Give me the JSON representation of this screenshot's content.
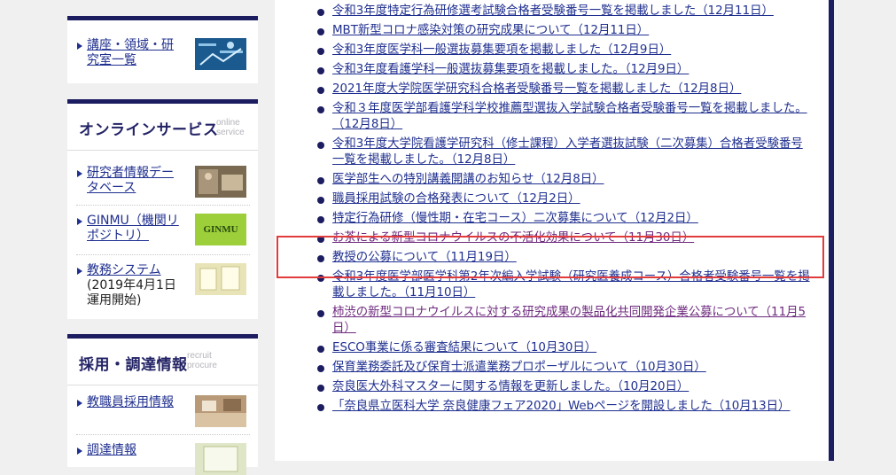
{
  "sidebar": {
    "course_link": "講座・領域・研究室一覧",
    "online": {
      "title_jp": "オンラインサービス",
      "title_en_1": "online",
      "title_en_2": "service",
      "items": [
        {
          "label": "研究者情報データベース",
          "sub": ""
        },
        {
          "label": "GINMU（機関リポジトリ）",
          "sub": "",
          "thumb_text": "GINMU"
        },
        {
          "label": "教務システム",
          "sub": "(2019年4月1日運用開始)"
        }
      ]
    },
    "recruit": {
      "title_jp": "採用・調達情報",
      "title_en_1": "recruit",
      "title_en_2": "procure",
      "items": [
        {
          "label": "教職員採用情報"
        },
        {
          "label": "調達情報"
        }
      ]
    }
  },
  "news": [
    {
      "text": "令和3年度特定行為研修選考試験合格者受験番号一覧を掲載しました（12月11日）",
      "visited": false
    },
    {
      "text": "MBT新型コロナ感染対策の研究成果について（12月11日）",
      "visited": false
    },
    {
      "text": "令和3年度医学科一般選抜募集要項を掲載しました（12月9日）",
      "visited": false
    },
    {
      "text": "令和3年度看護学科一般選抜募集要項を掲載しました。（12月9日）",
      "visited": false
    },
    {
      "text": "2021年度大学院医学研究科合格者受験番号一覧を掲載しました（12月8日）",
      "visited": false
    },
    {
      "text": "令和３年度医学部看護学科学校推薦型選抜入学試験合格者受験番号一覧を掲載しました。（12月8日）",
      "visited": false
    },
    {
      "text": "令和3年度大学院看護学研究科（修士課程）入学者選抜試験（二次募集）合格者受験番号一覧を掲載しました。（12月8日）",
      "visited": false
    },
    {
      "text": "医学部生への特別講義開講のお知らせ（12月8日）",
      "visited": false
    },
    {
      "text": "職員採用試験の合格発表について（12月2日）",
      "visited": false
    },
    {
      "text": "特定行為研修（慢性期・在宅コース）二次募集について（12月2日）",
      "visited": false
    },
    {
      "text": "お茶による新型コロナウイルスの不活化効果について（11月30日）",
      "visited": true
    },
    {
      "text": "教授の公募について（11月19日）",
      "visited": false
    },
    {
      "text": "令和3年度医学部医学科第2年次編入学試験（研究医養成コース）合格者受験番号一覧を掲載しました。（11月10日）",
      "visited": false
    },
    {
      "text": "柿渋の新型コロナウイルスに対する研究成果の製品化共同開発企業公募について（11月5日）",
      "visited": true
    },
    {
      "text": "ESCO事業に係る審査結果について（10月30日）",
      "visited": false
    },
    {
      "text": "保育業務委託及び保育士派遣業務プロポーザルについて（10月30日）",
      "visited": false
    },
    {
      "text": "奈良医大外科マスターに関する情報を更新しました。（10月20日）",
      "visited": false
    },
    {
      "text": "「奈良県立医科大学 奈良健康フェア2020」Webページを開設しました（10月13日）",
      "visited": false
    }
  ],
  "colors": {
    "navy": "#1c1c60",
    "link": "#1f2f8f",
    "visited": "#6e2a7e",
    "highlight": "#e23b3b"
  }
}
